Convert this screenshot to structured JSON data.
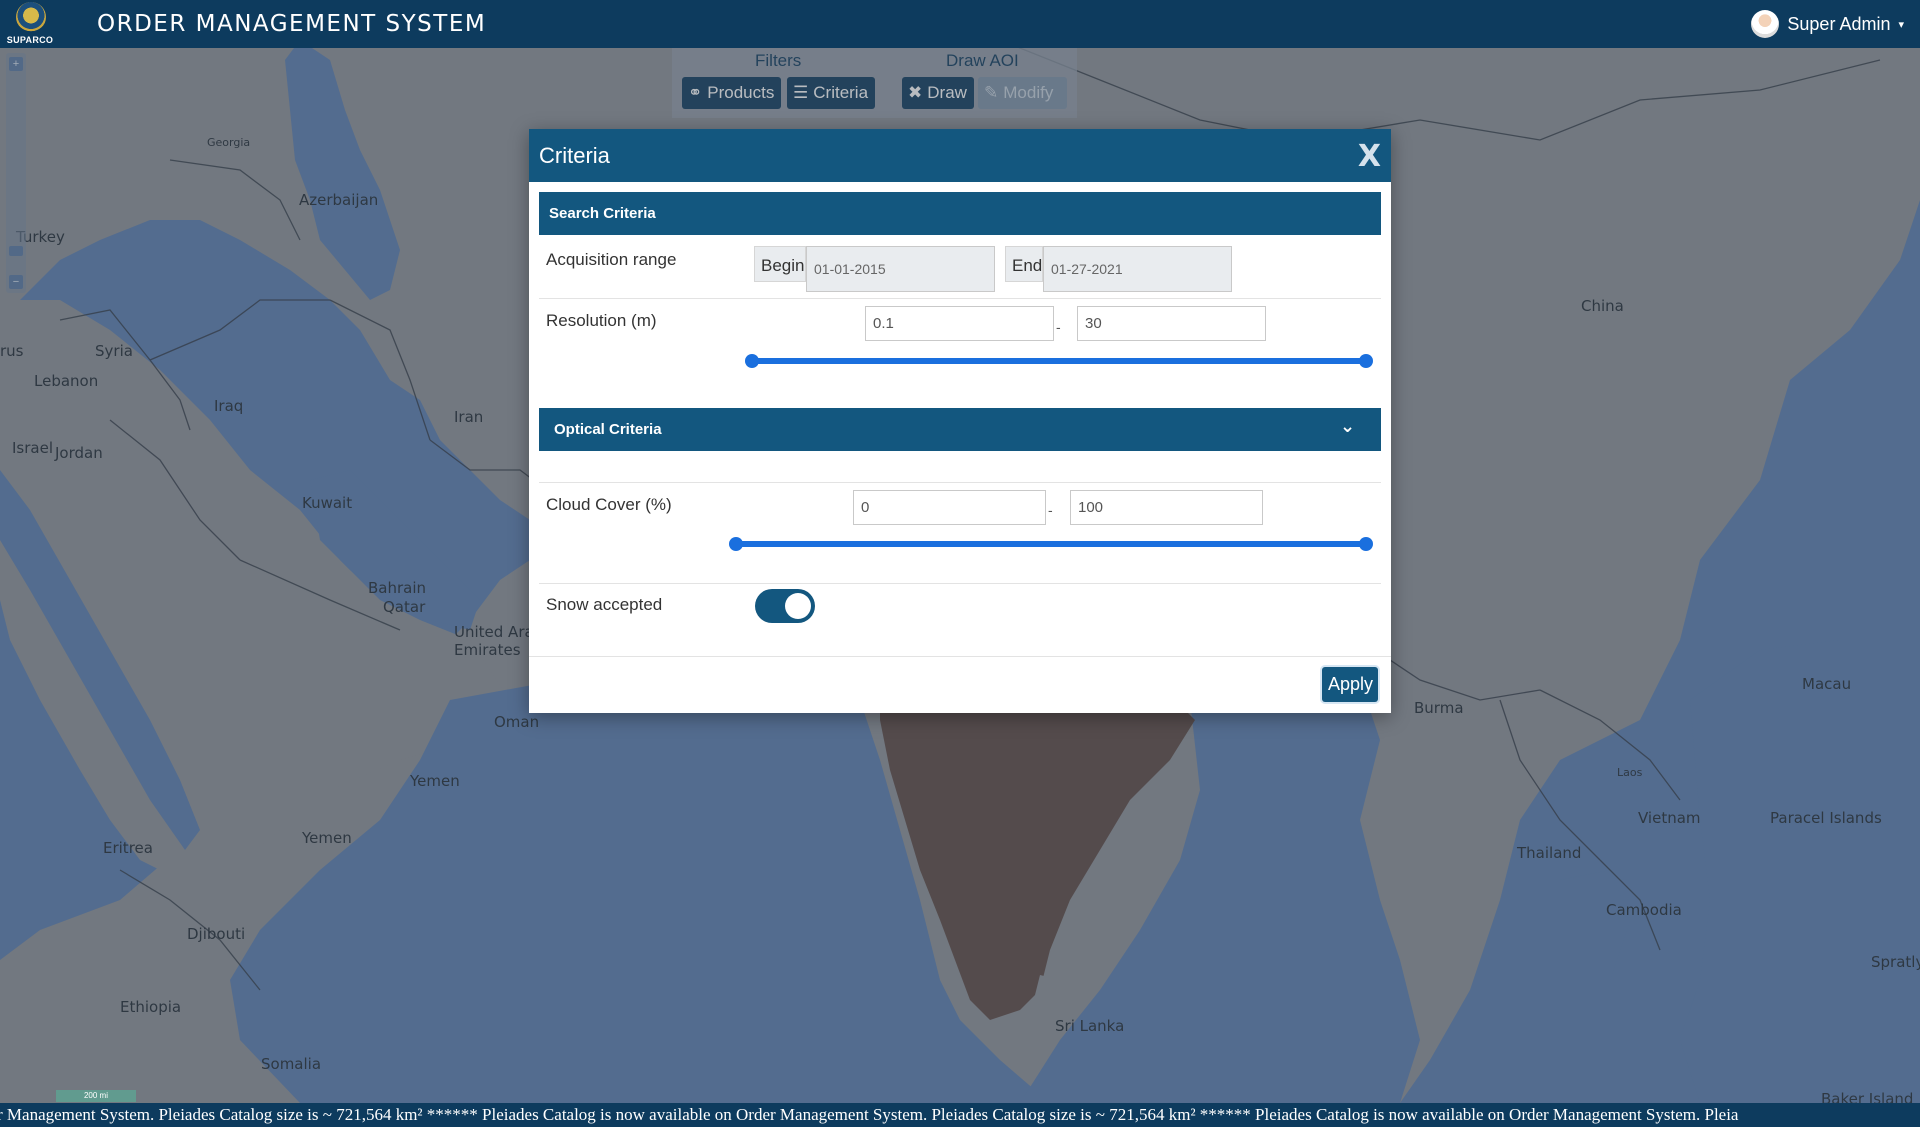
{
  "app": {
    "logo_text": "SUPARCO",
    "title": "ORDER MANAGEMENT SYSTEM",
    "user_name": "Super Admin",
    "user_caret": "▾"
  },
  "map_controls": {
    "zoom_in": "+",
    "zoom_out": "−"
  },
  "map_labels": [
    "Georgia",
    "Azerbaijan",
    "Turkey",
    "Syria",
    "Lebanon",
    "rus",
    "Israel",
    "Jordan",
    "Iraq",
    "Iran",
    "Kuwait",
    "Bahrain",
    "Qatar",
    "United Arab",
    "Emirates",
    "Oman",
    "Yemen",
    "Yemen",
    "Eritrea",
    "Djibouti",
    "Ethiopia",
    "Somalia",
    "China",
    "Burma",
    "Macau",
    "Laos",
    "Vietnam",
    "Paracel Islands",
    "Thailand",
    "Cambodia",
    "Spratly Islan",
    "Sri Lanka",
    "Baker Island"
  ],
  "scale_bar": "200 mi",
  "filters": {
    "group_title": "Filters",
    "products_label": "Products",
    "criteria_label": "Criteria"
  },
  "draw_aoi": {
    "group_title": "Draw AOI",
    "draw_label": "Draw",
    "modify_label": "Modify"
  },
  "modal": {
    "title": "Criteria",
    "close_label": "X",
    "search_section": "Search Criteria",
    "acquisition_label": "Acquisition range",
    "begin_label": "Begin",
    "begin_value": "01-01-2015",
    "end_label": "End",
    "end_value": "01-27-2021",
    "resolution_label": "Resolution (m)",
    "resolution_min": "0.1",
    "resolution_max": "30",
    "range_separator": "-",
    "optical_section": "Optical Criteria",
    "cloud_label": "Cloud Cover (%)",
    "cloud_min": "0",
    "cloud_max": "100",
    "snow_label": "Snow accepted",
    "snow_accepted": true,
    "apply_label": "Apply"
  },
  "ticker": {
    "text": "r Management System. Pleiades Catalog size is ~ 721,564 km²     ******     Pleiades Catalog is now available on Order Management System. Pleiades Catalog size is ~ 721,564 km²     ******     Pleiades Catalog is now available on Order Management System. Pleia"
  },
  "colors": {
    "header": "#0d3b5e",
    "section": "#13577f",
    "slider": "#1a6fde",
    "sea": "#5b7fb0",
    "land": "#8e9299"
  }
}
